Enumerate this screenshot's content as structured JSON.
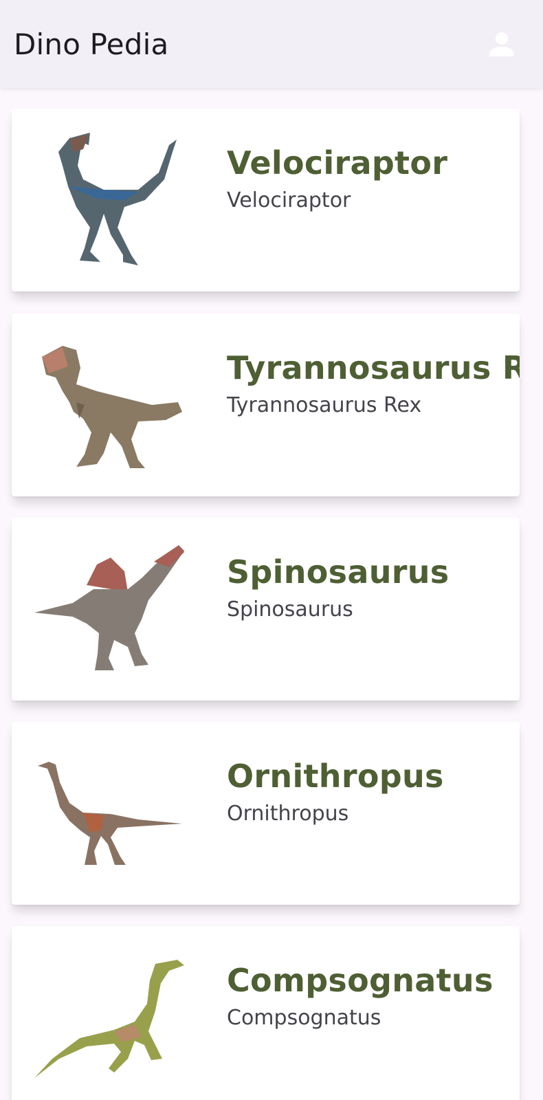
{
  "appbar": {
    "title": "Dino Pedia",
    "profile_icon": "person-icon"
  },
  "colors": {
    "appbar_bg": "#f3eff7",
    "page_bg": "#fcf7fc",
    "title_green": "#4e5f34",
    "subtitle_gray": "#45434a"
  },
  "dinosaurs": [
    {
      "title": "Velociraptor",
      "subtitle": "Velociraptor",
      "image": "velociraptor-image"
    },
    {
      "title": "Tyrannosaurus Rex",
      "subtitle": "Tyrannosaurus Rex",
      "image": "tyrannosaurus-image"
    },
    {
      "title": "Spinosaurus",
      "subtitle": "Spinosaurus",
      "image": "spinosaurus-image"
    },
    {
      "title": "Ornithropus",
      "subtitle": "Ornithropus",
      "image": "ornithropus-image"
    },
    {
      "title": "Compsognatus",
      "subtitle": "Compsognatus",
      "image": "compsognatus-image"
    }
  ]
}
